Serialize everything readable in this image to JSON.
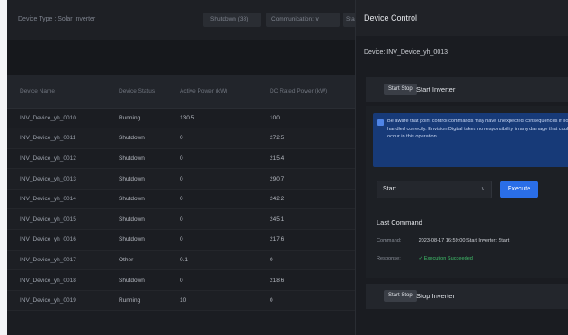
{
  "filters": {
    "device_type": "Device Type : Solar Inverter",
    "status": "Shutdown (38)",
    "comm": "Communication: ∨",
    "more": "Sta"
  },
  "table": {
    "headers": [
      "Device Name",
      "Device Status",
      "Active Power (kW)",
      "DC Rated Power (kW)"
    ],
    "rows": [
      [
        "INV_Device_yh_0010",
        "Running",
        "130.5",
        "100"
      ],
      [
        "INV_Device_yh_0011",
        "Shutdown",
        "0",
        "272.5"
      ],
      [
        "INV_Device_yh_0012",
        "Shutdown",
        "0",
        "215.4"
      ],
      [
        "INV_Device_yh_0013",
        "Shutdown",
        "0",
        "290.7"
      ],
      [
        "INV_Device_yh_0014",
        "Shutdown",
        "0",
        "242.2"
      ],
      [
        "INV_Device_yh_0015",
        "Shutdown",
        "0",
        "245.1"
      ],
      [
        "INV_Device_yh_0016",
        "Shutdown",
        "0",
        "217.6"
      ],
      [
        "INV_Device_yh_0017",
        "Other",
        "0.1",
        "0"
      ],
      [
        "INV_Device_yh_0018",
        "Shutdown",
        "0",
        "218.6"
      ],
      [
        "INV_Device_yh_0019",
        "Running",
        "10",
        "0"
      ]
    ]
  },
  "drawer": {
    "title": "Device Control",
    "device": "Device: INV_Device_yh_0013",
    "start_section": {
      "button": "Start Stop",
      "label": "Start Inverter"
    },
    "notice": "Be aware that point control commands may have unexpected consequences if not handled correctly. Envision Digital takes no responsibility in any damage that could occur in this operation.",
    "select_value": "Start",
    "execute_label": "Execute",
    "last_command": {
      "title": "Last Command",
      "command_key": "Command:",
      "command_value": "2023-08-17 16:59:00 Start Inverter: Start",
      "response_key": "Response:",
      "response_value": "✓ Execution Succeeded"
    },
    "stop_section": {
      "button": "Start Stop",
      "label": "Stop Inverter"
    }
  },
  "colors": {
    "accent": "#2a6ee8",
    "notice_bg": "#173a78",
    "success": "#3fbf6a"
  }
}
